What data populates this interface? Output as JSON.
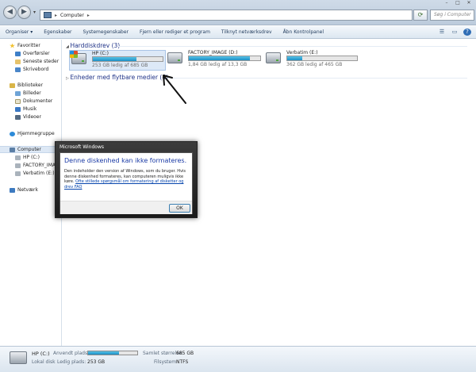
{
  "window": {
    "address_label": "Computer",
    "search_placeholder": "Søg i Computer",
    "min_glyph": "–",
    "max_glyph": "□",
    "close_glyph": "✕",
    "back_glyph": "◀",
    "forward_glyph": "▶",
    "dropdown_glyph": "▾",
    "chevron_glyph": "▸",
    "refresh_glyph": "⟳"
  },
  "toolbar": {
    "items": [
      "Organiser ▾",
      "Egenskaber",
      "Systemegenskaber",
      "Fjern eller rediger et program",
      "Tilknyt netværksdrev",
      "Åbn Kontrolpanel"
    ],
    "view_glyph": "☰",
    "preview_glyph": "▭",
    "help_glyph": "?"
  },
  "sidebar": {
    "favorites": "Favoritter",
    "downloads": "Overførsler",
    "recent": "Seneste steder",
    "desktop": "Skrivebord",
    "libraries": "Biblioteker",
    "pictures": "Billeder",
    "documents": "Dokumenter",
    "music": "Musik",
    "videos": "Videoer",
    "homegroup": "Hjemmegruppe",
    "computer": "Computer",
    "drive_c": "HP (C:)",
    "drive_d": "FACTORY_IMAGE",
    "drive_e": "Verbatim (E:)",
    "network": "Netværk"
  },
  "main": {
    "group_hdd": "Harddiskdrev (3)",
    "group_removable": "Enheder med flytbare medier (4)",
    "drives": [
      {
        "name": "HP (C:)",
        "free": "253 GB ledig af 685 GB",
        "used_fraction": 0.63
      },
      {
        "name": "FACTORY_IMAGE (D:)",
        "free": "1,84 GB ledig af 13,3 GB",
        "used_fraction": 0.86
      },
      {
        "name": "Verbatim (E:)",
        "free": "362 GB ledig af 465 GB",
        "used_fraction": 0.22
      }
    ]
  },
  "status": {
    "drive_name": "HP (C:)",
    "drive_type": "Lokal disk",
    "used_label": "Anvendt plads:",
    "free_label": "Ledig plads:",
    "free_value": "253 GB",
    "total_label": "Samlet størrelse:",
    "total_value": "685 GB",
    "fs_label": "Filsystem:",
    "fs_value": "NTFS",
    "used_fraction": 0.63
  },
  "dialog": {
    "title": "Microsoft Windows",
    "heading": "Denne diskenhed kan ikke formateres.",
    "body": "Den indeholder den version af Windows, som du bruger. Hvis denne diskenhed formateres, kan computeren muligvis ikke køre.",
    "link": "Ofte stillede spørgsmål om formatering af disketter og drev FAQ",
    "ok": "OK"
  },
  "colors": {
    "accent": "#1e3287",
    "bar_fill": "#1d8fc4",
    "link": "#0645ad"
  }
}
